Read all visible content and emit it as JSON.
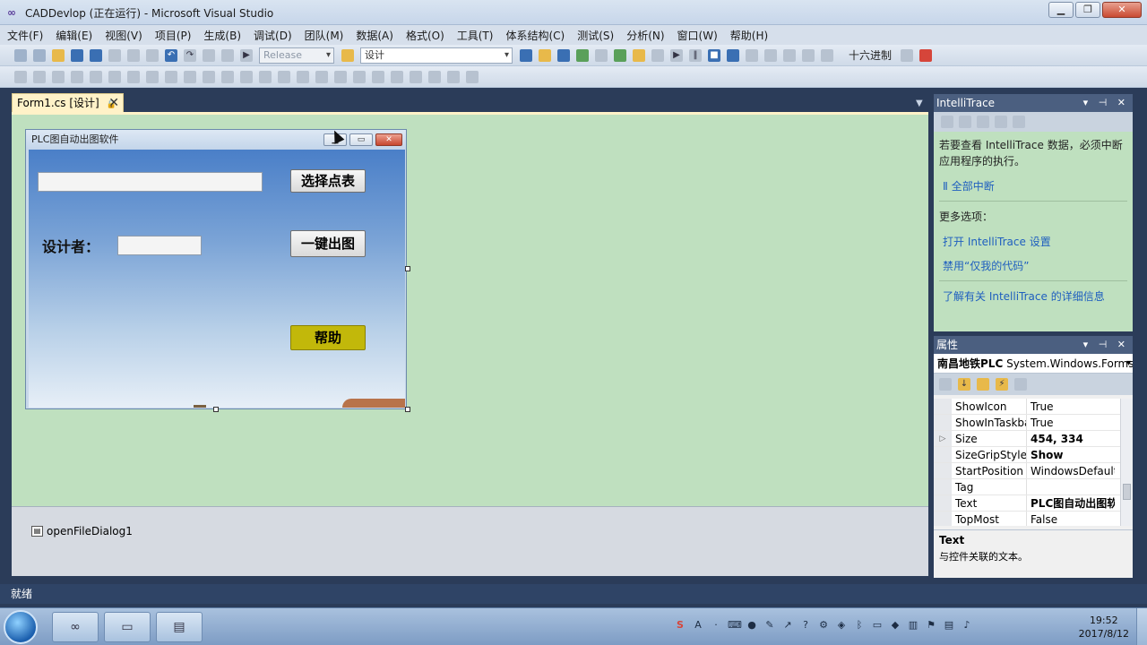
{
  "window": {
    "title": "CADDevlop (正在运行) - Microsoft Visual Studio",
    "app_icon": "visual-studio-icon",
    "min_glyph": "▁",
    "max_glyph": "❐",
    "close_glyph": "✕"
  },
  "menu": [
    "文件(F)",
    "编辑(E)",
    "视图(V)",
    "项目(P)",
    "生成(B)",
    "调试(D)",
    "团队(M)",
    "数据(A)",
    "格式(O)",
    "工具(T)",
    "体系结构(C)",
    "测试(S)",
    "分析(N)",
    "窗口(W)",
    "帮助(H)"
  ],
  "toolbar": {
    "config": "Release",
    "platform": "设计",
    "hex_label": "十六进制"
  },
  "document": {
    "tab_label": "Form1.cs [设计]",
    "pin_glyph": "🔒",
    "close_glyph": "✕"
  },
  "form": {
    "title": "PLC图自动出图软件",
    "btn_select": "选择点表",
    "btn_generate": "一键出图",
    "btn_help": "帮助",
    "label_designer": "设计者：",
    "colors": {
      "help_button": "#c2b80a",
      "sky_top": "#4a7fc8"
    }
  },
  "tray": {
    "component": "openFileDialog1"
  },
  "intellitrace": {
    "title": "IntelliTrace",
    "message": "若要查看 IntelliTrace 数据，必须中断应用程序的执行。",
    "break_all": "全部中断",
    "more_options": "更多选项：",
    "link_settings": "打开 IntelliTrace 设置",
    "link_disable": "禁用“仅我的代码”",
    "link_learn": "了解有关 IntelliTrace 的详细信息"
  },
  "properties": {
    "title": "属性",
    "object_name": "南昌地铁PLC",
    "object_type": "System.Windows.Forms.",
    "rows": [
      {
        "name": "ShowIcon",
        "value": "True",
        "bold": false,
        "expand": ""
      },
      {
        "name": "ShowInTaskba",
        "value": "True",
        "bold": false,
        "expand": ""
      },
      {
        "name": "Size",
        "value": "454, 334",
        "bold": true,
        "expand": "▷"
      },
      {
        "name": "SizeGripStyle",
        "value": "Show",
        "bold": true,
        "expand": ""
      },
      {
        "name": "StartPosition",
        "value": "WindowsDefaultLc",
        "bold": false,
        "expand": ""
      },
      {
        "name": "Tag",
        "value": "",
        "bold": false,
        "expand": ""
      },
      {
        "name": "Text",
        "value": "PLC图自动出图软件",
        "bold": true,
        "expand": ""
      },
      {
        "name": "TopMost",
        "value": "False",
        "bold": false,
        "expand": ""
      }
    ],
    "desc_title": "Text",
    "desc_text": "与控件关联的文本。"
  },
  "status": {
    "text": "就绪"
  },
  "taskbar": {
    "time": "19:52",
    "date": "2017/8/12"
  }
}
